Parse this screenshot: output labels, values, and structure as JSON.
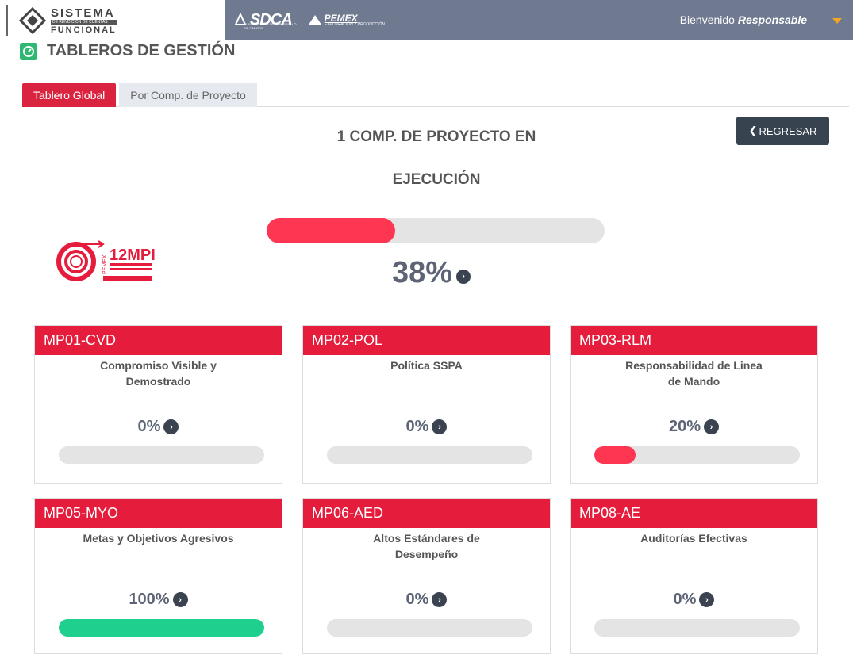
{
  "brand": {
    "line1": "SISTEMA",
    "line2": "DE RENDICION DE CUENTAS",
    "line3": "FUNCIONAL"
  },
  "navbar": {
    "sdca": "SDCA",
    "sdca_sub": "SUBDIRECCIÓN DE DESARROLLO DE CAMPOS",
    "pemex": "PEMEX",
    "pemex_sub": "EXPLORACIÓN Y PRODUCCIÓN",
    "welcome_prefix": "Bienvenido ",
    "welcome_user": "Responsable"
  },
  "page": {
    "title": "TABLEROS DE GESTIÓN"
  },
  "tabs": [
    {
      "label": "Tablero Global",
      "active": true
    },
    {
      "label": "Por Comp. de Proyecto",
      "active": false
    }
  ],
  "summary": {
    "line1": "1 COMP. DE PROYECTO EN",
    "line2": "EJECUCIÓN",
    "percent": "38%",
    "progress": 0.38,
    "back_label": "REGRESAR"
  },
  "logo_12mpi": {
    "text": "12MPI",
    "tag": "PEMEX"
  },
  "colors": {
    "accent": "#e51c3c",
    "bar_red": "#ff3651",
    "bar_green": "#1fcf8d",
    "track": "#e4e4e4"
  },
  "cards": [
    {
      "code": "MP01-CVD",
      "title": "Compromiso Visible y Demostrado",
      "percent": "0%",
      "progress": 0,
      "color": "#ff3651"
    },
    {
      "code": "MP02-POL",
      "title": "Política SSPA",
      "percent": "0%",
      "progress": 0,
      "color": "#ff3651"
    },
    {
      "code": "MP03-RLM",
      "title": "Responsabilidad de Linea de Mando",
      "percent": "20%",
      "progress": 0.2,
      "color": "#ff3651"
    },
    {
      "code": "MP05-MYO",
      "title": "Metas y Objetivos Agresivos",
      "percent": "100%",
      "progress": 1,
      "color": "#1fcf8d"
    },
    {
      "code": "MP06-AED",
      "title": "Altos Estándares de Desempeño",
      "percent": "0%",
      "progress": 0,
      "color": "#ff3651"
    },
    {
      "code": "MP08-AE",
      "title": "Auditorías Efectivas",
      "percent": "0%",
      "progress": 0,
      "color": "#ff3651"
    }
  ]
}
